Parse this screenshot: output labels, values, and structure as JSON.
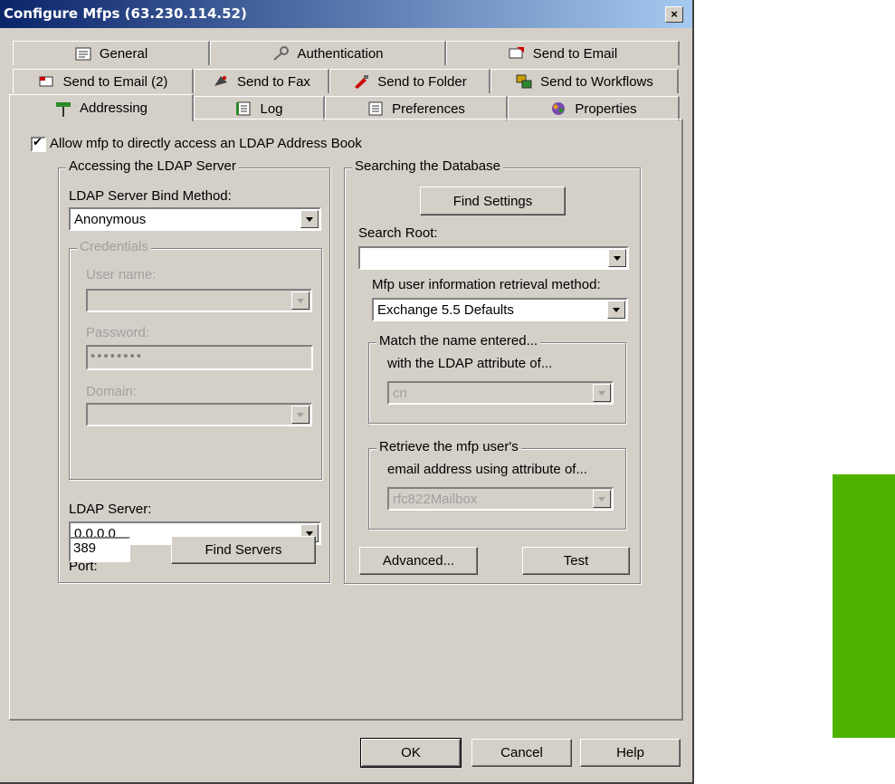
{
  "window": {
    "title": "Configure Mfps (63.230.114.52)",
    "close_label": "×"
  },
  "tabs": {
    "row1": [
      "General",
      "Authentication",
      "Send to Email"
    ],
    "row2": [
      "Send to Email (2)",
      "Send to Fax",
      "Send to Folder",
      "Send to Workflows"
    ],
    "row3": [
      "Addressing",
      "Log",
      "Preferences",
      "Properties"
    ],
    "active": "Addressing"
  },
  "ldap": {
    "allow_label": "Allow mfp to directly access an LDAP Address Book",
    "allow_checked": true,
    "server_group": {
      "title": "Accessing the LDAP Server",
      "bind_method_label": "LDAP Server Bind Method:",
      "bind_method_value": "Anonymous",
      "credentials": {
        "title": "Credentials",
        "username_label": "User name:",
        "username_value": "",
        "password_label": "Password:",
        "password_value": "••••••••",
        "domain_label": "Domain:",
        "domain_value": ""
      },
      "server_label": "LDAP Server:",
      "server_value": "0.0.0.0",
      "port_label": "Port:",
      "port_value": "389",
      "find_servers_label": "Find Servers"
    },
    "search_group": {
      "title": "Searching the Database",
      "find_settings_label": "Find Settings",
      "search_root_label": "Search Root:",
      "search_root_value": "",
      "retrieval_label": "Mfp user information retrieval method:",
      "retrieval_value": "Exchange 5.5 Defaults",
      "match": {
        "title": "Match the name entered...",
        "label": "with the LDAP attribute of...",
        "value": "cn"
      },
      "retrieve": {
        "title": "Retrieve the mfp user's",
        "label": "email address using attribute of...",
        "value": "rfc822Mailbox"
      },
      "advanced_label": "Advanced...",
      "test_label": "Test"
    }
  },
  "footer": {
    "ok_label": "OK",
    "cancel_label": "Cancel",
    "help_label": "Help"
  },
  "colors": {
    "dialog_bg": "#d4d0c8",
    "title_start": "#0a246a",
    "title_end": "#a6caf0",
    "side_accent": "#4db300"
  }
}
